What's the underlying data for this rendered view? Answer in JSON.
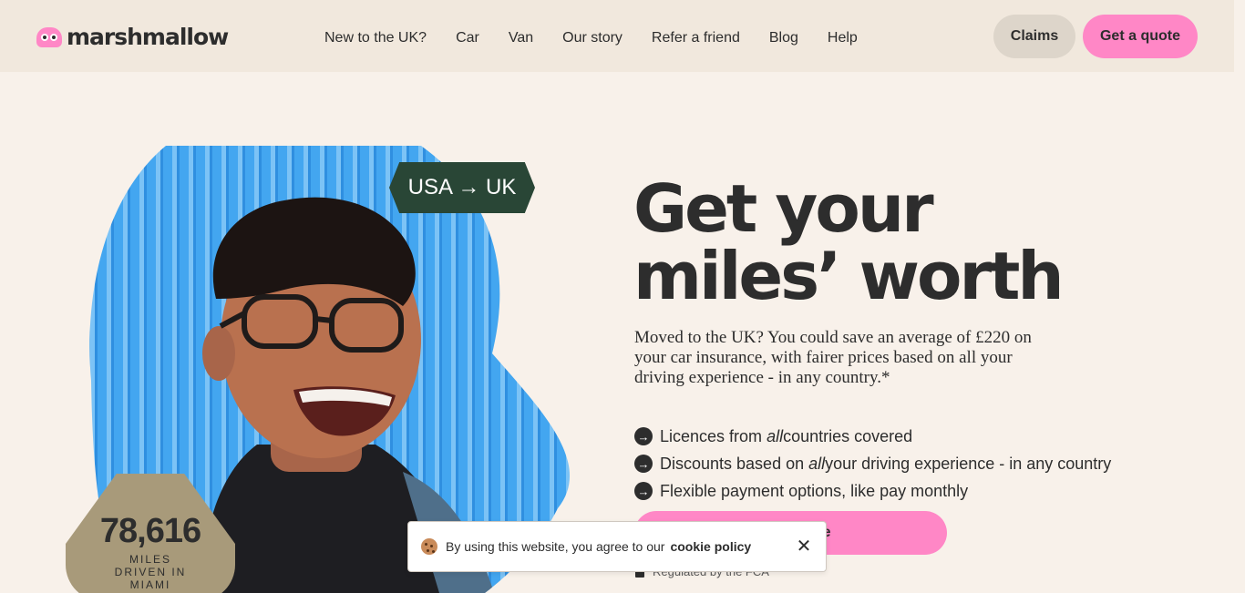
{
  "header": {
    "logo_text": "marshmallow",
    "nav": [
      "New to the UK?",
      "Car",
      "Van",
      "Our story",
      "Refer a friend",
      "Blog",
      "Help"
    ],
    "claims_label": "Claims",
    "quote_label": "Get a quote"
  },
  "hero": {
    "route_badge": "USA → UK",
    "miles_value": "78,616",
    "miles_label": "MILES DRIVEN IN MIAMI",
    "title_line1": "Get your",
    "title_line2": "miles’ worth",
    "description": "Moved to the UK? You could save an average of £220 on your car insurance, with fairer prices based on all your driving experience - in any country.*",
    "features": [
      {
        "pre": "Licences from ",
        "em": "all",
        "post": " countries covered"
      },
      {
        "pre": "Discounts based on ",
        "em": "all",
        "post": " your driving experience - in any country"
      },
      {
        "pre": "Flexible payment options, like pay monthly",
        "em": "",
        "post": ""
      }
    ],
    "cta_label": "Get a quote",
    "regulated_text": "Regulated by the FCA"
  },
  "cookie": {
    "text": "By using this website, you agree to our",
    "link": "cookie policy",
    "close": "✕"
  },
  "colors": {
    "pink": "#ff87c6",
    "background": "#f8f1ea",
    "header_bg": "#f1e8dd",
    "dark_green": "#294636",
    "badge_tan": "#a89a7a",
    "sky_blue": "#3fa2ee"
  }
}
